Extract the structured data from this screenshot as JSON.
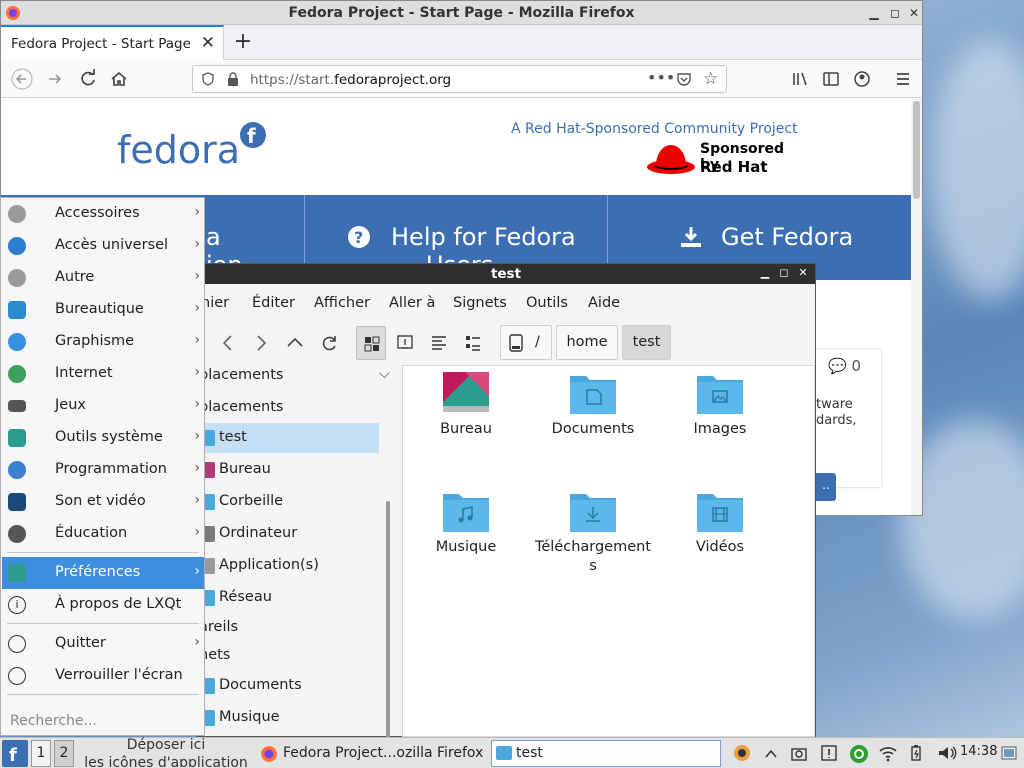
{
  "firefox": {
    "window_title": "Fedora Project - Start Page - Mozilla Firefox",
    "tab_title": "Fedora Project - Start Page",
    "url_prefix": "https://start.",
    "url_domain": "fedoraproject.org",
    "page": {
      "logo_text": "fedora",
      "tagline": "A Red Hat-Sponsored Community Project",
      "sponsored_by": "Sponsored by",
      "redhat": "Red Hat",
      "nav_items": [
        "a",
        "Help for Fedora",
        "Get Fedora"
      ],
      "nav_second_line": [
        "ion",
        "Users"
      ],
      "comment_count": "0",
      "card_text_1": "tware",
      "card_text_2": "dards,",
      "card_button": ".."
    }
  },
  "file_manager": {
    "title": "test",
    "menu": [
      "hier",
      "Éditer",
      "Afficher",
      "Aller à",
      "Signets",
      "Outils",
      "Aide"
    ],
    "breadcrumbs": [
      "/",
      "home",
      "test"
    ],
    "sidebar": {
      "header": "placements",
      "items": [
        {
          "label": "placements",
          "kind": "section"
        },
        {
          "label": "test",
          "kind": "item",
          "selected": true
        },
        {
          "label": "Bureau",
          "kind": "item"
        },
        {
          "label": "Corbeille",
          "kind": "item"
        },
        {
          "label": "Ordinateur",
          "kind": "item"
        },
        {
          "label": "Application(s)",
          "kind": "item"
        },
        {
          "label": "Réseau",
          "kind": "item"
        },
        {
          "label": "areils",
          "kind": "section"
        },
        {
          "label": "nets",
          "kind": "section"
        },
        {
          "label": "Documents",
          "kind": "item"
        },
        {
          "label": "Musique",
          "kind": "item"
        }
      ]
    },
    "files": [
      {
        "name": "Bureau",
        "icon": "desktop-folder-icon"
      },
      {
        "name": "Documents",
        "icon": "documents-folder-icon"
      },
      {
        "name": "Images",
        "icon": "pictures-folder-icon"
      },
      {
        "name": "Musique",
        "icon": "music-folder-icon"
      },
      {
        "name": "Téléchargements",
        "icon": "downloads-folder-icon"
      },
      {
        "name": "Vidéos",
        "icon": "videos-folder-icon"
      }
    ]
  },
  "start_menu": {
    "items": [
      {
        "label": "Accessoires",
        "icon": "accessories-icon",
        "submenu": true
      },
      {
        "label": "Accès universel",
        "icon": "accessibility-icon",
        "submenu": true
      },
      {
        "label": "Autre",
        "icon": "other-icon",
        "submenu": true
      },
      {
        "label": "Bureautique",
        "icon": "office-icon",
        "submenu": true
      },
      {
        "label": "Graphisme",
        "icon": "graphics-icon",
        "submenu": true
      },
      {
        "label": "Internet",
        "icon": "internet-icon",
        "submenu": true
      },
      {
        "label": "Jeux",
        "icon": "games-icon",
        "submenu": true
      },
      {
        "label": "Outils système",
        "icon": "system-tools-icon",
        "submenu": true
      },
      {
        "label": "Programmation",
        "icon": "programming-icon",
        "submenu": true
      },
      {
        "label": "Son et vidéo",
        "icon": "multimedia-icon",
        "submenu": true
      },
      {
        "label": "Éducation",
        "icon": "education-icon",
        "submenu": true
      }
    ],
    "preferences": "Préférences",
    "about": "À propos de LXQt",
    "quit": "Quitter",
    "lock": "Verrouiller l'écran",
    "search_placeholder": "Recherche..."
  },
  "taskbar": {
    "desktop_1": "1",
    "desktop_2": "2",
    "quicklaunch_hint_1": "Déposer ici",
    "quicklaunch_hint_2": "les icônes d'application",
    "task_firefox": "Fedora Project...ozilla Firefox",
    "task_fm": "test",
    "clock": "14:38"
  },
  "colors": {
    "fedora_blue": "#3c6eb4",
    "selection": "#3d8ee0",
    "folder": "#4aa8dc"
  }
}
